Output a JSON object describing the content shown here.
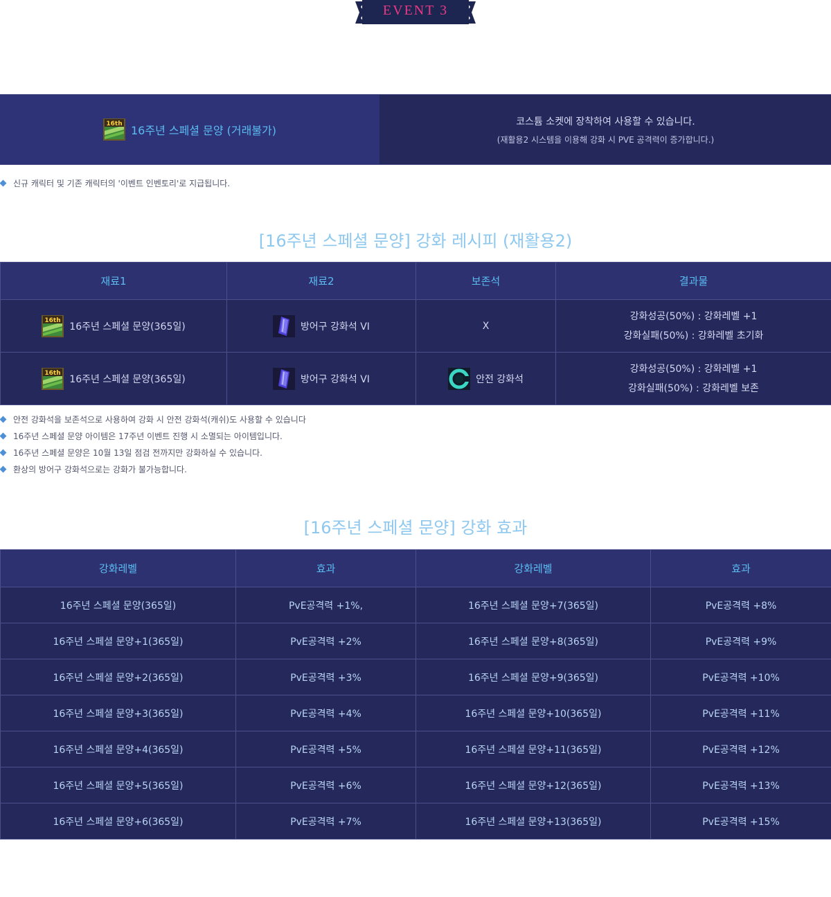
{
  "banner": {
    "label": "EVENT 3"
  },
  "event_item": {
    "name": "16주년 스페셜 문양 (거래불가)",
    "icon": "16th-pattern-icon",
    "desc_line1": "코스튬 소켓에 장착하여 사용할 수 있습니다.",
    "desc_line2": "(재활용2 시스템을 이용해 강화 시 PVE 공격력이 증가합니다.)"
  },
  "notes_top": [
    "신규 캐릭터 및 기존 캐릭터의 '이벤트 인벤토리'로 지급됩니다."
  ],
  "recipe": {
    "title": "[16주년 스페셜 문양] 강화 레시피 (재활용2)",
    "headers": [
      "재료1",
      "재료2",
      "보존석",
      "결과물"
    ],
    "rows": [
      {
        "mat1": "16주년 스페셜 문양(365일)",
        "mat2": "방어구 강화석 VI",
        "protect": "X",
        "result1": "강화성공(50%) : 강화레벨 +1",
        "result2": "강화실패(50%) : 강화레벨 초기화"
      },
      {
        "mat1": "16주년 스페셜 문양(365일)",
        "mat2": "방어구 강화석 VI",
        "protect": "안전 강화석",
        "result1": "강화성공(50%) : 강화레벨 +1",
        "result2": "강화실패(50%) : 강화레벨 보존"
      }
    ]
  },
  "notes_recipe": [
    "안전 강화석을 보존석으로 사용하여 강화 시 안전 강화석(캐쉬)도 사용할 수 있습니다",
    "16주년 스페셜 문양 아이템은 17주년 이벤트 진행 시 소멸되는 아이템입니다.",
    "16주년 스페셜 문양은 10월 13일 점검 전까지만 강화하실 수 있습니다.",
    "환상의 방어구 강화석으로는 강화가 불가능합니다."
  ],
  "effect": {
    "title": "[16주년 스페셜 문양] 강화 효과",
    "headers": [
      "강화레벨",
      "효과",
      "강화레벨",
      "효과"
    ],
    "rows": [
      [
        "16주년 스페셜 문양(365일)",
        "PvE공격력 +1%,",
        "16주년 스페셜 문양+7(365일)",
        "PvE공격력 +8%"
      ],
      [
        "16주년 스페셜 문양+1(365일)",
        "PvE공격력 +2%",
        "16주년 스페셜 문양+8(365일)",
        "PvE공격력 +9%"
      ],
      [
        "16주년 스페셜 문양+2(365일)",
        "PvE공격력 +3%",
        "16주년 스페셜 문양+9(365일)",
        "PvE공격력 +10%"
      ],
      [
        "16주년 스페셜 문양+3(365일)",
        "PvE공격력 +4%",
        "16주년 스페셜 문양+10(365일)",
        "PvE공격력 +11%"
      ],
      [
        "16주년 스페셜 문양+4(365일)",
        "PvE공격력 +5%",
        "16주년 스페셜 문양+11(365일)",
        "PvE공격력 +12%"
      ],
      [
        "16주년 스페셜 문양+5(365일)",
        "PvE공격력 +6%",
        "16주년 스페셜 문양+12(365일)",
        "PvE공격력 +13%"
      ],
      [
        "16주년 스페셜 문양+6(365일)",
        "PvE공격력 +7%",
        "16주년 스페셜 문양+13(365일)",
        "PvE공격력 +15%"
      ]
    ]
  },
  "colors": {
    "banner_bg": "#1d2650",
    "banner_text": "#e83a84",
    "box_dark": "#25285a",
    "box_light": "#2e3276",
    "header_text": "#5bbcf2",
    "title_text": "#8ec8ef",
    "note_bullet": "#4e8fd6"
  }
}
